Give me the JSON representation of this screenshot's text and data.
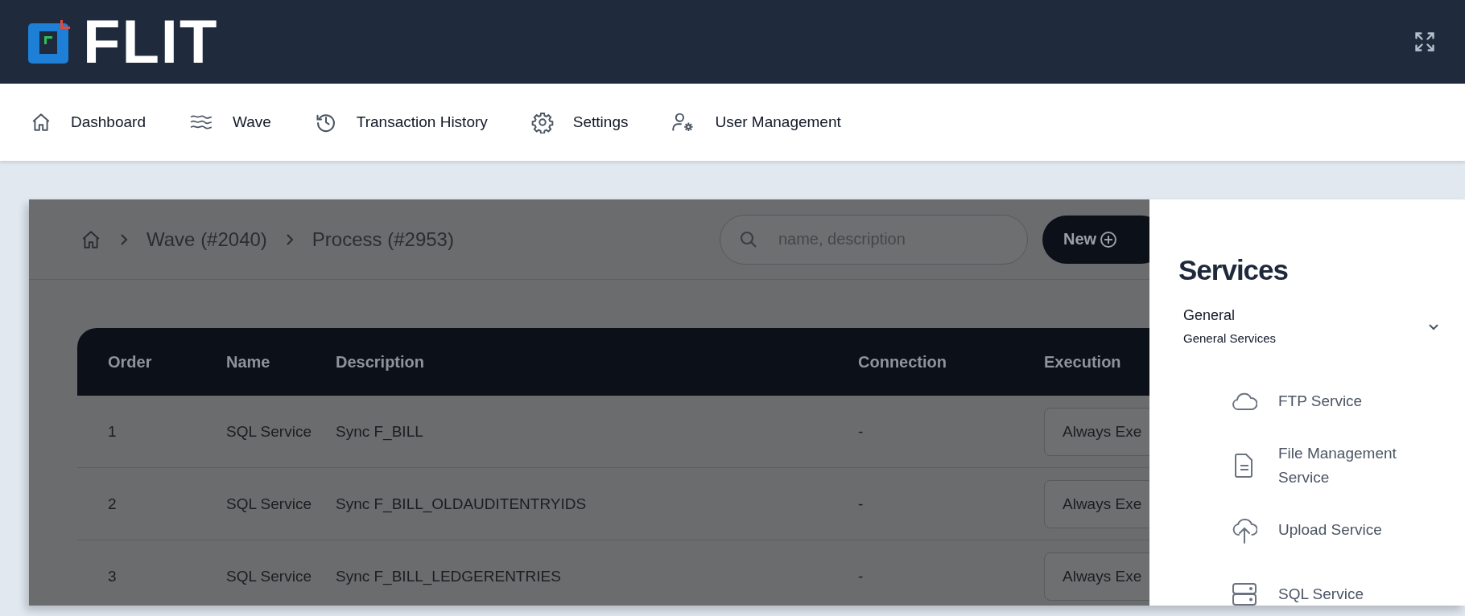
{
  "header": {
    "logo_text": "FLIT"
  },
  "nav": [
    {
      "label": "Dashboard",
      "kind": "home"
    },
    {
      "label": "Wave",
      "kind": "waves"
    },
    {
      "label": "Transaction History",
      "kind": "history"
    },
    {
      "label": "Settings",
      "kind": "gear"
    },
    {
      "label": "User Management",
      "kind": "user-gear"
    }
  ],
  "breadcrumb": [
    "Wave (#2040)",
    "Process (#2953)"
  ],
  "search": {
    "placeholder": "name, description"
  },
  "new_button": "New",
  "table": {
    "columns": [
      "Order",
      "Name",
      "Description",
      "Connection",
      "Execution"
    ],
    "rows": [
      {
        "order": "1",
        "name": "SQL Service",
        "description": "Sync F_BILL",
        "connection": "-",
        "execution": "Always Exe"
      },
      {
        "order": "2",
        "name": "SQL Service",
        "description": "Sync F_BILL_OLDAUDITENTRYIDS",
        "connection": "-",
        "execution": "Always Exe"
      },
      {
        "order": "3",
        "name": "SQL Service",
        "description": "Sync F_BILL_LEDGERENTRIES",
        "connection": "-",
        "execution": "Always Exe"
      }
    ]
  },
  "drawer": {
    "title": "Services",
    "group": {
      "title": "General",
      "subtitle": "General Services",
      "expanded": true,
      "items": [
        {
          "label": "FTP Service",
          "kind": "cloud"
        },
        {
          "label": "File Management Service",
          "kind": "file"
        },
        {
          "label": "Upload Service",
          "kind": "upload"
        },
        {
          "label": "SQL Service",
          "kind": "server"
        }
      ]
    }
  }
}
